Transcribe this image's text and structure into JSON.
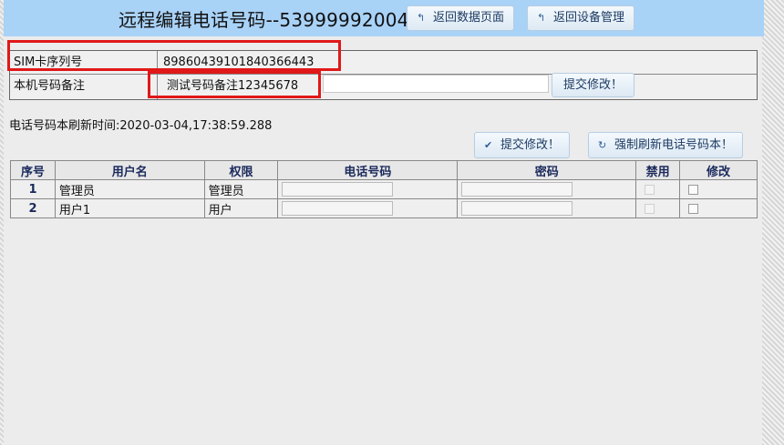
{
  "header": {
    "title": "远程编辑电话号码--53999992004",
    "back_data_page": "返回数据页面",
    "back_device_mgmt": "返回设备管理",
    "icon": "↰"
  },
  "info": {
    "sim_label": "SIM卡序列号",
    "sim_value": "89860439101840366443",
    "remark_label": "本机号码备注",
    "remark_value": "测试号码备注12345678",
    "extra_input_value": "",
    "submit_label": "提交修改！"
  },
  "phonebook": {
    "refresh_time": "电话号码本刷新时间:2020-03-04,17:38:59.288",
    "submit_label": "提交修改！",
    "force_refresh_label": "强制刷新电话号码本！",
    "check_icon": "✔",
    "refresh_icon": "↻"
  },
  "table": {
    "headers": [
      "序号",
      "用户名",
      "权限",
      "电话号码",
      "密码",
      "禁用",
      "修改"
    ],
    "rows": [
      {
        "seq": "1",
        "username": "管理员",
        "permission": "管理员",
        "phone": "",
        "password": "",
        "disabled": false,
        "modify": false
      },
      {
        "seq": "2",
        "username": "用户1",
        "permission": "用户",
        "phone": "",
        "password": "",
        "disabled": false,
        "modify": false
      }
    ]
  },
  "colors": {
    "header_bg": "#a9d2f7",
    "highlight_red": "#e01818",
    "header_text": "#1b2a5c"
  }
}
